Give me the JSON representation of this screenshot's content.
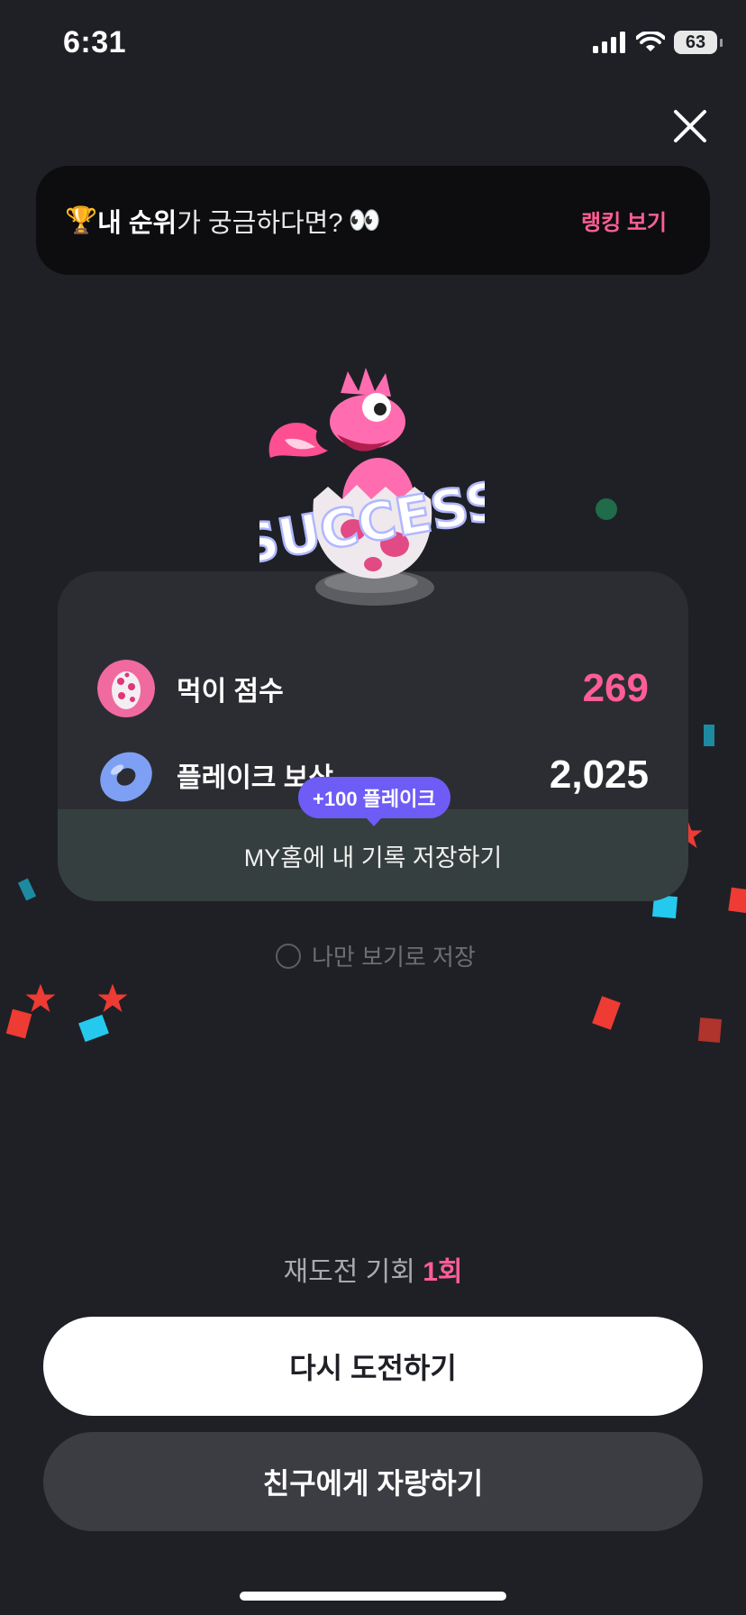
{
  "status_bar": {
    "time": "6:31",
    "battery": "63"
  },
  "rank_banner": {
    "emoji": "🏆",
    "highlight": "내 순위",
    "rest": "가 궁금하다면?",
    "eyes": "👀",
    "link": "랭킹 보기"
  },
  "result": {
    "success_text": "SUCCESS",
    "score_label": "먹이 점수",
    "score_value": "269",
    "reward_label": "플레이크 보상",
    "reward_value": "2,025",
    "bonus_bubble": "+100 플레이크",
    "save_label": "MY홈에 내 기록 저장하기"
  },
  "private_option": {
    "label": "나만 보기로 저장"
  },
  "retry": {
    "text": "재도전 기회",
    "count": "1회"
  },
  "buttons": {
    "retry": "다시 도전하기",
    "share": "친구에게 자랑하기"
  },
  "colors": {
    "accent": "#ff5d95",
    "bubble": "#6e5cf6",
    "background": "#1f2026"
  }
}
